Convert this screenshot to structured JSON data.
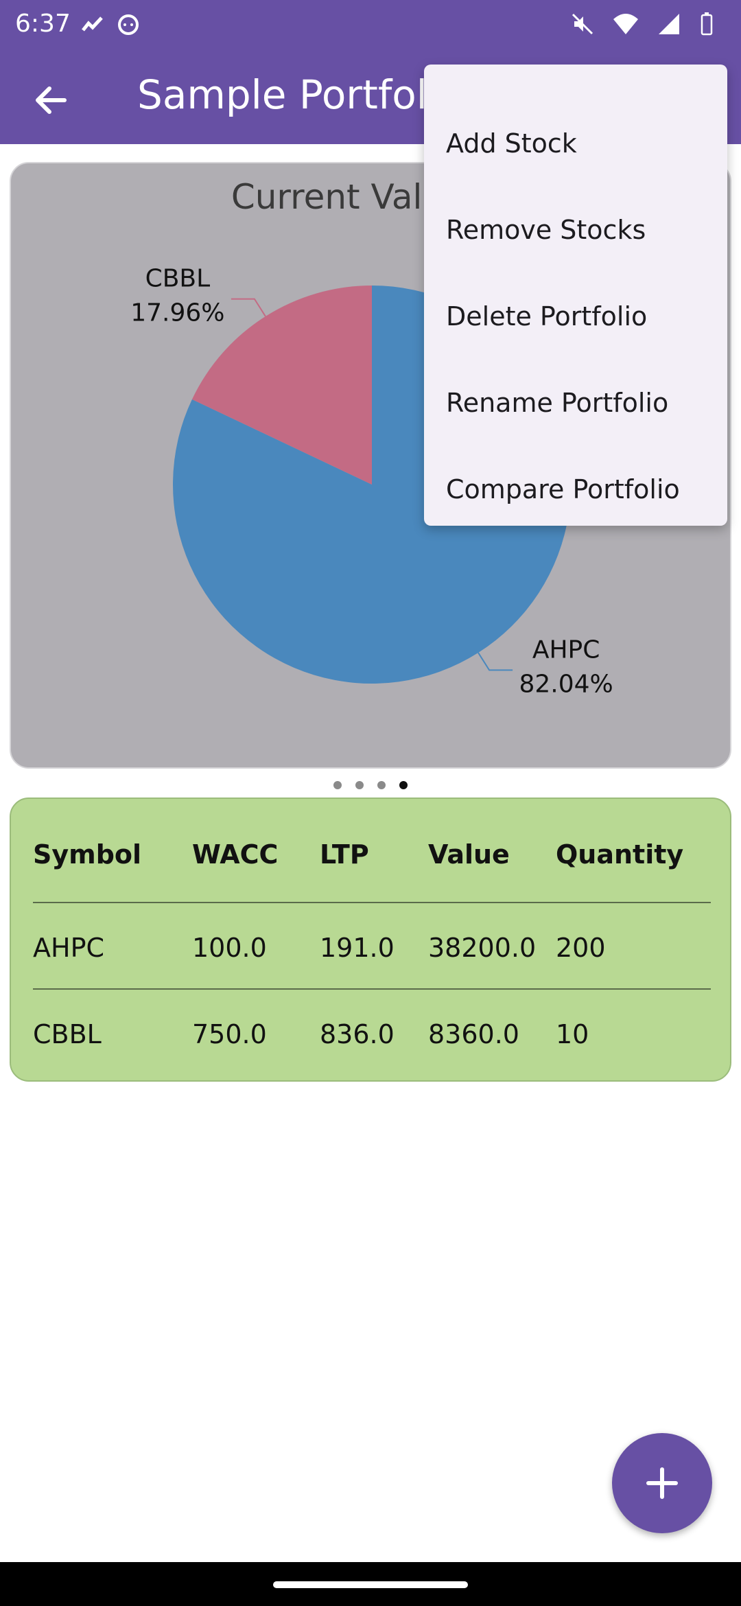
{
  "status_bar": {
    "time": "6:37",
    "left_icons": [
      "stocks-app-icon",
      "cat-app-icon"
    ],
    "right_icons": [
      "mute-icon",
      "wifi-icon",
      "signal-icon",
      "battery-icon"
    ]
  },
  "app_bar": {
    "title": "Sample Portfolio",
    "back_icon": "arrow-left-icon"
  },
  "chart_card": {
    "title": "Current Value W"
  },
  "chart_data": {
    "type": "pie",
    "title": "Current Value W",
    "slices": [
      {
        "label": "AHPC",
        "percent": 82.04,
        "color": "#4a88bd"
      },
      {
        "label": "CBBL",
        "percent": 17.96,
        "color": "#c36b84"
      }
    ]
  },
  "pager": {
    "count": 4,
    "active": 3
  },
  "table": {
    "headers": [
      "Symbol",
      "WACC",
      "LTP",
      "Value",
      "Quantity"
    ],
    "rows": [
      [
        "AHPC",
        "100.0",
        "191.0",
        "38200.0",
        "200"
      ],
      [
        "CBBL",
        "750.0",
        "836.0",
        "8360.0",
        "10"
      ]
    ]
  },
  "menu": {
    "items": [
      {
        "label": "Add Stock"
      },
      {
        "label": "Remove Stocks"
      },
      {
        "label": "Delete Portfolio"
      },
      {
        "label": "Rename Portfolio"
      },
      {
        "label": "Compare Portfolio"
      }
    ]
  },
  "fab": {
    "icon": "plus-icon"
  },
  "colors": {
    "primary": "#6750a4",
    "chart_bg": "#b0aeb3",
    "table_bg": "#b8d993",
    "menu_bg": "#f3eff7"
  }
}
